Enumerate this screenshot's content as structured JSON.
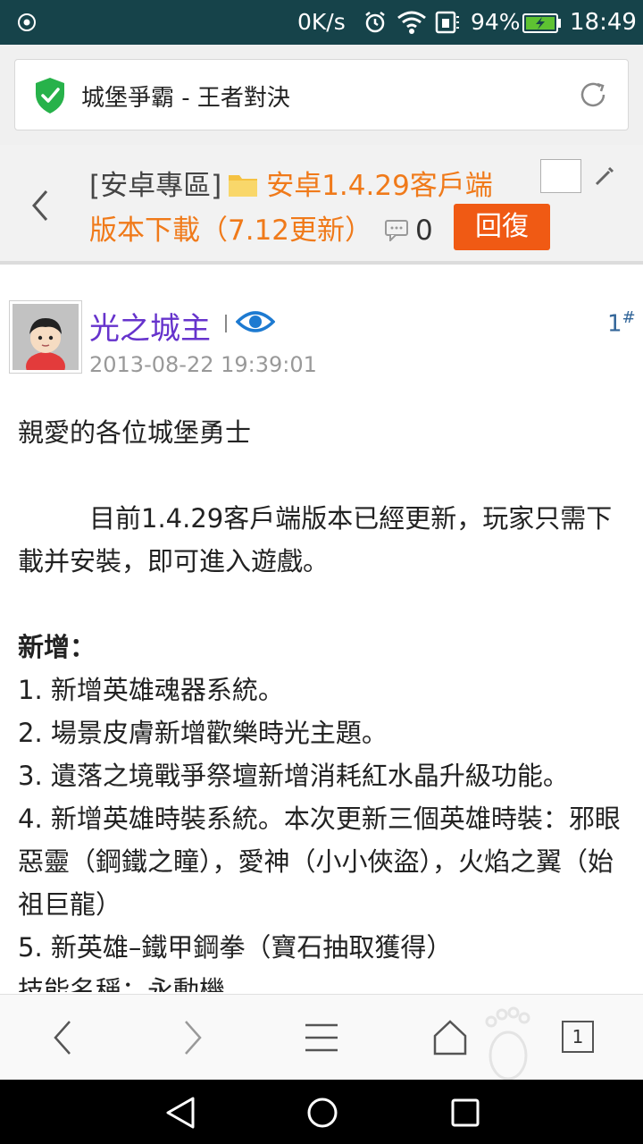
{
  "status_bar": {
    "speed": "0K/s",
    "battery_percent": "94%",
    "time": "18:49",
    "icons": [
      "notification-icon",
      "alarm-icon",
      "wifi-icon",
      "sim-icon",
      "battery-charging-icon"
    ]
  },
  "address_bar": {
    "title": "城堡爭霸 - 王者對決",
    "icons": [
      "shield-check-icon",
      "reload-icon"
    ]
  },
  "thread": {
    "tag": "[安卓專區]",
    "title_part1": "安卓1.4.29客戶端",
    "title_part2": "版本下載（7.12更新）",
    "reply_count": "0",
    "reply_button": "回復",
    "accent_color": "#f07a1a",
    "button_color": "#f05a14"
  },
  "post": {
    "author": "光之城主",
    "floor": "1",
    "floor_suffix": "#",
    "date": "2013-08-22 19:39:01",
    "lines": {
      "greeting": "親愛的各位城堡勇士",
      "intro": "目前1.4.29客戶端版本已經更新，玩家只需下載并安裝，即可進入遊戲。",
      "section_title": "新增：",
      "item1": "1. 新增英雄魂器系統。",
      "item2": "2. 場景皮膚新增歡樂時光主題。",
      "item3": "3. 遺落之境戰爭祭壇新增消耗紅水晶升級功能。",
      "item4": "4. 新增英雄時裝系統。本次更新三個英雄時裝：邪眼惡靈（鋼鐵之瞳），愛神（小小俠盜），火焰之翼（始祖巨龍）",
      "item5": "5. 新英雄–鐵甲鋼拳（寶石抽取獲得）",
      "item6": "技能名稱：永動機"
    }
  },
  "toolbar": {
    "tab_count": "1",
    "icons": [
      "back-icon",
      "forward-icon",
      "menu-icon",
      "home-icon",
      "tabs-icon"
    ]
  },
  "nav_bar": {
    "icons": [
      "nav-back-icon",
      "nav-home-icon",
      "nav-recents-icon"
    ]
  }
}
